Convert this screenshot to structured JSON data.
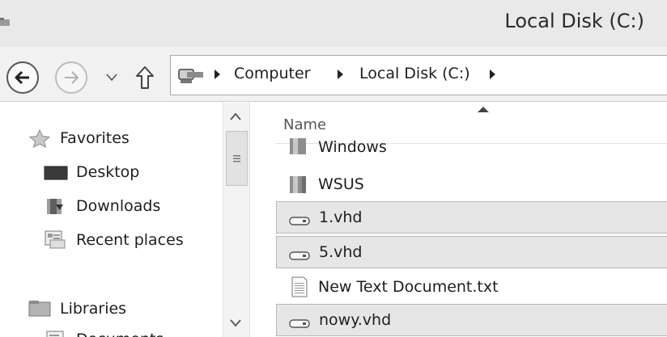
{
  "window": {
    "title": "Local Disk (C:)"
  },
  "address": {
    "crumbs": [
      "Computer",
      "Local Disk (C:)"
    ],
    "icons": {
      "back": "back-arrow-icon",
      "forward": "forward-arrow-icon",
      "recent": "dropdown-chevron-icon",
      "up": "up-arrow-icon",
      "location": "computer-icon"
    }
  },
  "navpane": {
    "items": [
      {
        "label": "Favorites",
        "icon": "star-icon"
      },
      {
        "label": "Desktop",
        "icon": "desktop-icon"
      },
      {
        "label": "Downloads",
        "icon": "downloads-icon"
      },
      {
        "label": "Recent places",
        "icon": "recent-places-icon"
      },
      {
        "label": "Libraries",
        "icon": "libraries-icon"
      },
      {
        "label": "Documents",
        "icon": "documents-icon"
      }
    ]
  },
  "content": {
    "column_header": "Name",
    "files": [
      {
        "name": "Windows",
        "type": "folder",
        "selected": false
      },
      {
        "name": "WSUS",
        "type": "folder",
        "selected": false
      },
      {
        "name": "1.vhd",
        "type": "vhd",
        "selected": true
      },
      {
        "name": "5.vhd",
        "type": "vhd",
        "selected": true
      },
      {
        "name": "New Text Document.txt",
        "type": "text",
        "selected": false
      },
      {
        "name": "nowy.vhd",
        "type": "vhd",
        "selected": true
      }
    ]
  },
  "colors": {
    "selection": "#e6e6e6",
    "selection_border": "#b8b8b8",
    "titlebar": "#e9e9e9"
  }
}
